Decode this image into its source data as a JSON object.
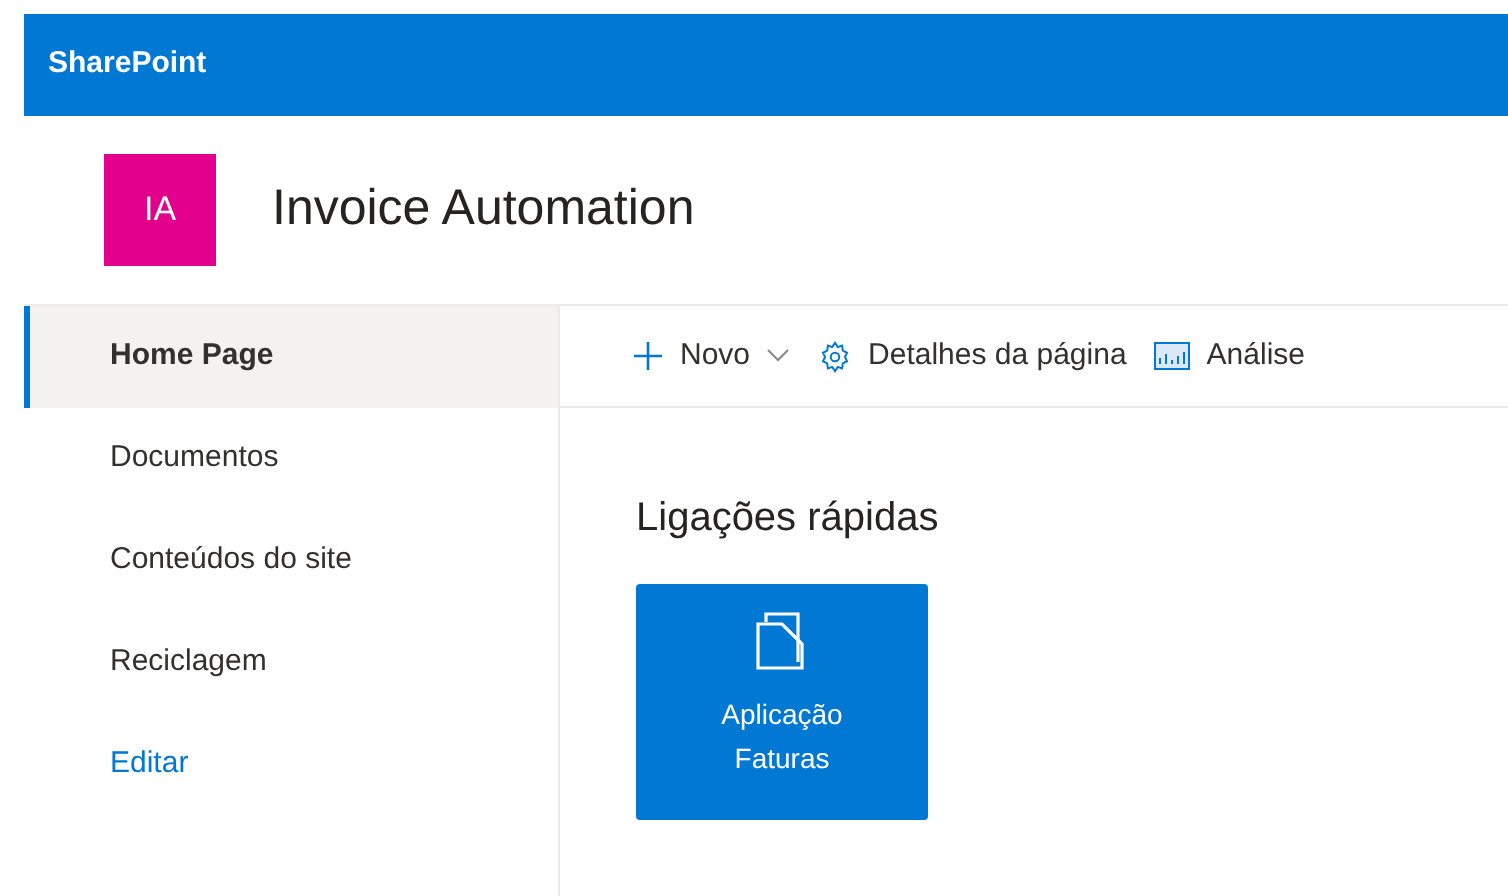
{
  "app_bar": {
    "title": "SharePoint"
  },
  "site": {
    "logo": "IA",
    "title": "Invoice Automation"
  },
  "nav": [
    {
      "label": "Home Page",
      "selected": true,
      "kind": "item"
    },
    {
      "label": "Documentos",
      "selected": false,
      "kind": "item"
    },
    {
      "label": "Conteúdos do site",
      "selected": false,
      "kind": "item"
    },
    {
      "label": "Reciclagem",
      "selected": false,
      "kind": "item"
    },
    {
      "label": "Editar",
      "selected": false,
      "kind": "link"
    }
  ],
  "command_bar": [
    {
      "kind": "new",
      "label": "Novo"
    },
    {
      "kind": "details",
      "label": "Detalhes da página"
    },
    {
      "kind": "analytics",
      "label": "Análise"
    }
  ],
  "quick_links": {
    "title": "Ligações rápidas",
    "tiles": [
      {
        "label": "Aplicação Faturas"
      }
    ]
  }
}
